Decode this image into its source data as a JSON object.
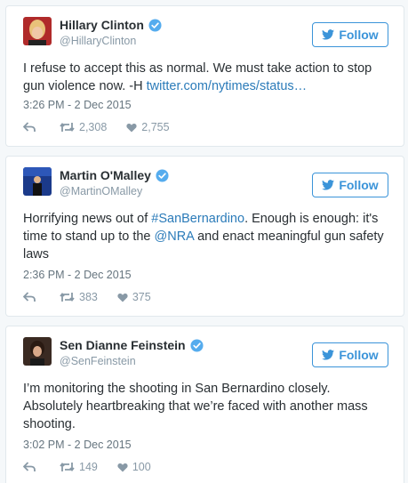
{
  "colors": {
    "accent": "#3b94d9",
    "link": "#2b7bb9",
    "muted": "#8899a6",
    "border": "#e1e8ed"
  },
  "tweets": [
    {
      "name": "Hillary Clinton",
      "handle": "@HillaryClinton",
      "follow_label": "Follow",
      "text_parts": [
        "I refuse to accept this as normal. We must take action to stop gun violence now. -H ",
        "twitter.com/nytimes/status…"
      ],
      "timestamp": "3:26 PM - 2 Dec 2015",
      "retweets": "2,308",
      "likes": "2,755"
    },
    {
      "name": "Martin O'Malley",
      "handle": "@MartinOMalley",
      "follow_label": "Follow",
      "text_parts": [
        "Horrifying news out of ",
        "#SanBernardino",
        ". Enough is enough: it's time to stand up to the ",
        "@NRA",
        " and enact meaningful gun safety laws"
      ],
      "timestamp": "2:36 PM - 2 Dec 2015",
      "retweets": "383",
      "likes": "375"
    },
    {
      "name": "Sen Dianne Feinstein",
      "handle": "@SenFeinstein",
      "follow_label": "Follow",
      "text_parts": [
        "I’m monitoring the shooting in San Bernardino closely. Absolutely heartbreaking that we’re faced with another mass shooting."
      ],
      "timestamp": "3:02 PM - 2 Dec 2015",
      "retweets": "149",
      "likes": "100"
    }
  ]
}
